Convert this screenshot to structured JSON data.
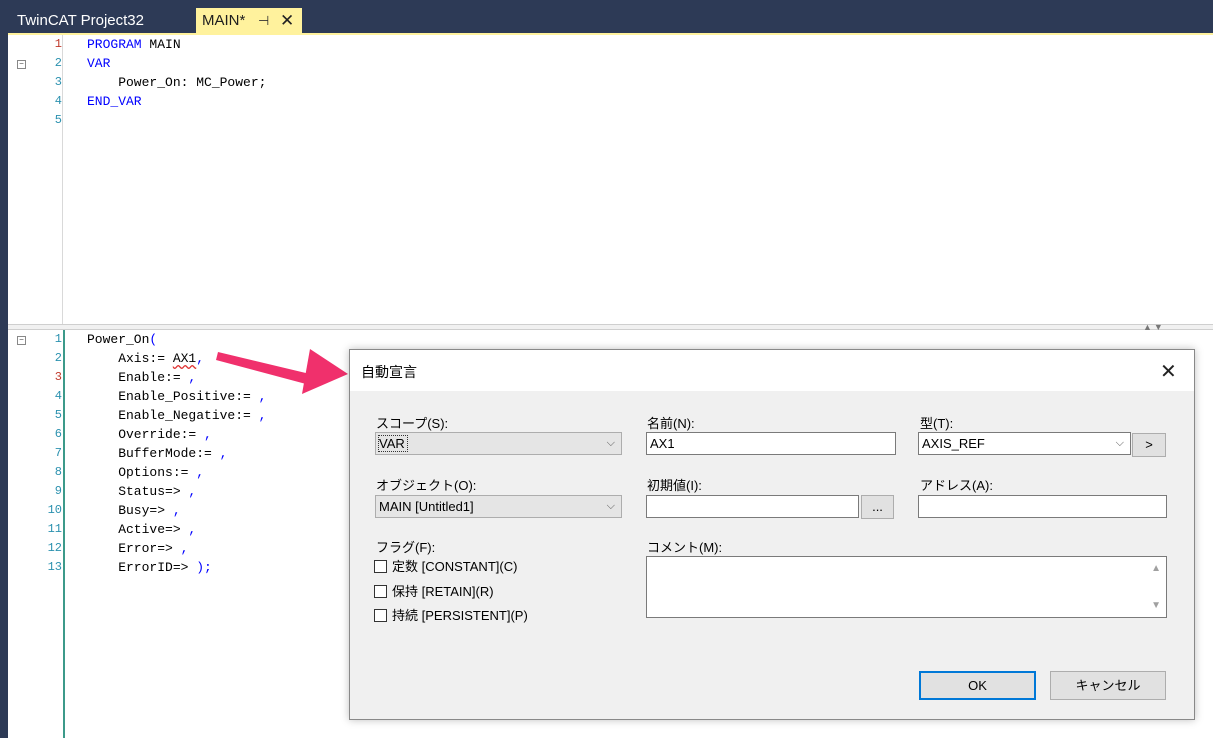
{
  "tabs": {
    "project": "TwinCAT Project32",
    "main": "MAIN*",
    "pin_glyph": "⊣",
    "close_glyph": "✕"
  },
  "declaration": {
    "line_numbers": [
      "1",
      "2",
      "3",
      "4",
      "5"
    ],
    "lines": [
      {
        "kw": "PROGRAM",
        "rest": " MAIN"
      },
      {
        "kw": "VAR",
        "rest": ""
      },
      {
        "kw": "",
        "rest": "    Power_On: MC_Power;"
      },
      {
        "kw": "END_VAR",
        "rest": ""
      },
      {
        "kw": "",
        "rest": ""
      }
    ]
  },
  "implementation": {
    "line_numbers": [
      "1",
      "2",
      "3",
      "4",
      "5",
      "6",
      "7",
      "8",
      "9",
      "10",
      "11",
      "12",
      "13"
    ],
    "lines": [
      {
        "pre": "Power_On",
        "kw": "(",
        "post": ""
      },
      {
        "pre": "    Axis:= ",
        "err": "AX1",
        "kw": ",",
        "post": ""
      },
      {
        "pre": "    Enable:= ",
        "kw": ",",
        "post": ""
      },
      {
        "pre": "    Enable_Positive:= ",
        "kw": ",",
        "post": ""
      },
      {
        "pre": "    Enable_Negative:= ",
        "kw": ",",
        "post": ""
      },
      {
        "pre": "    Override:= ",
        "kw": ",",
        "post": ""
      },
      {
        "pre": "    BufferMode:= ",
        "kw": ",",
        "post": ""
      },
      {
        "pre": "    Options:= ",
        "kw": ",",
        "post": ""
      },
      {
        "pre": "    Status=> ",
        "kw": ",",
        "post": ""
      },
      {
        "pre": "    Busy=> ",
        "kw": ",",
        "post": ""
      },
      {
        "pre": "    Active=> ",
        "kw": ",",
        "post": ""
      },
      {
        "pre": "    Error=> ",
        "kw": ",",
        "post": ""
      },
      {
        "pre": "    ErrorID=> ",
        "kw": ");",
        "post": ""
      }
    ]
  },
  "dialog": {
    "title": "自動宣言",
    "scope_label": "スコープ(S):",
    "scope_value": "VAR",
    "name_label": "名前(N):",
    "name_value": "AX1",
    "type_label": "型(T):",
    "type_value": "AXIS_REF",
    "type_button": ">",
    "object_label": "オブジェクト(O):",
    "object_value": "MAIN [Untitled1]",
    "init_label": "初期値(I):",
    "init_value": "",
    "init_button": "...",
    "address_label": "アドレス(A):",
    "address_value": "",
    "flags_label": "フラグ(F):",
    "flags": [
      "定数 [CONSTANT](C)",
      "保持 [RETAIN](R)",
      "持続 [PERSISTENT](P)"
    ],
    "comment_label": "コメント(M):",
    "ok": "OK",
    "cancel": "キャンセル"
  },
  "colors": {
    "tab_active": "#fff29d",
    "chrome": "#2d3a56",
    "keyword": "#0000ff",
    "arrow": "#f0306c"
  }
}
